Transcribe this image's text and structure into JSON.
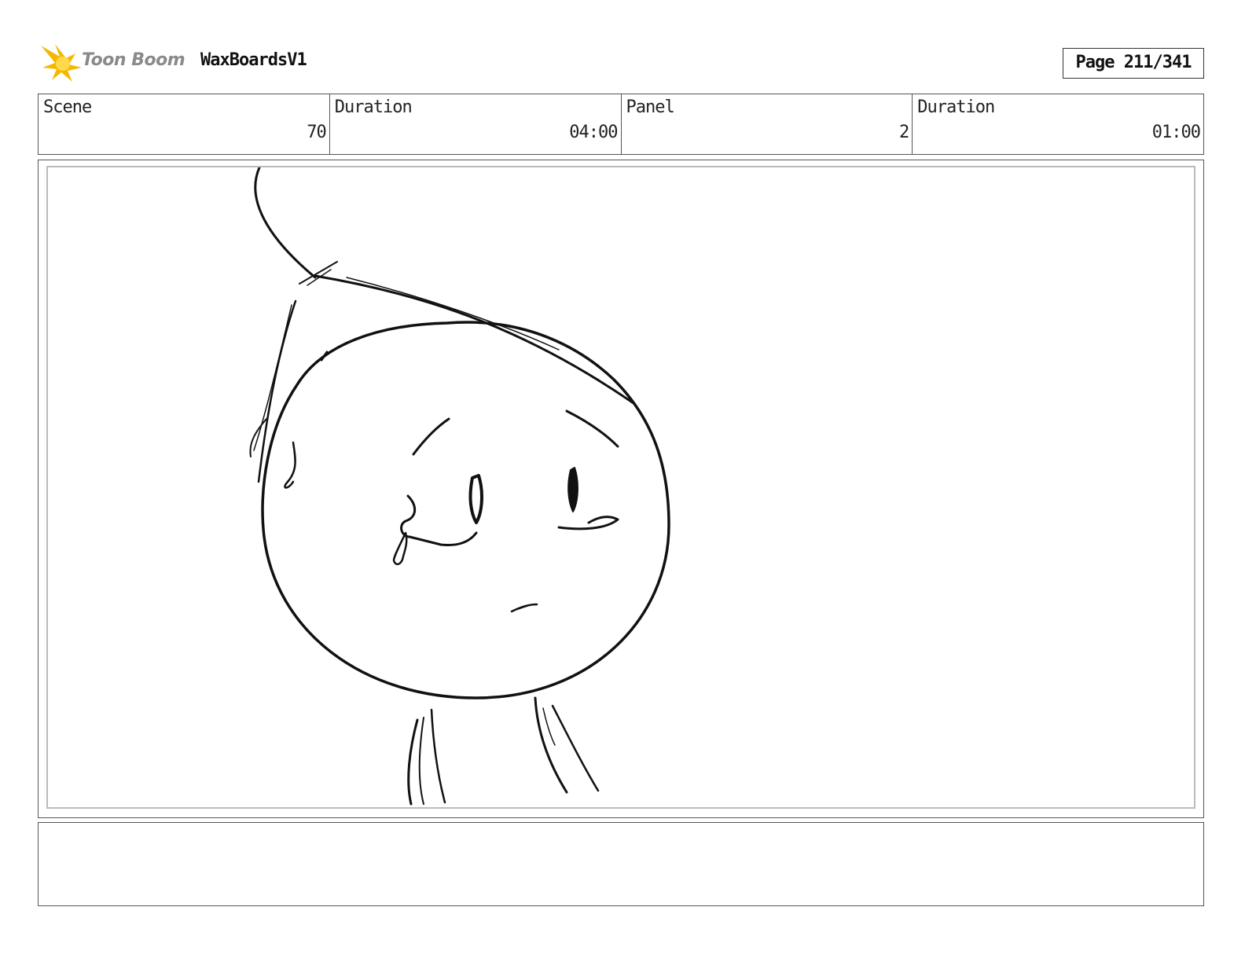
{
  "header": {
    "logo_text": "Toon Boom",
    "project_title": "WaxBoardsV1",
    "page_label": "Page 211/341"
  },
  "info": {
    "scene_label": "Scene",
    "scene_value": "70",
    "scene_duration_label": "Duration",
    "scene_duration_value": "04:00",
    "panel_label": "Panel",
    "panel_value": "2",
    "panel_duration_label": "Duration",
    "panel_duration_value": "01:00"
  },
  "notes": {
    "text": ""
  },
  "colors": {
    "logo_star": "#f5b800",
    "logo_text": "#8a8a8a",
    "border": "#555555",
    "sketch": "#111111"
  }
}
